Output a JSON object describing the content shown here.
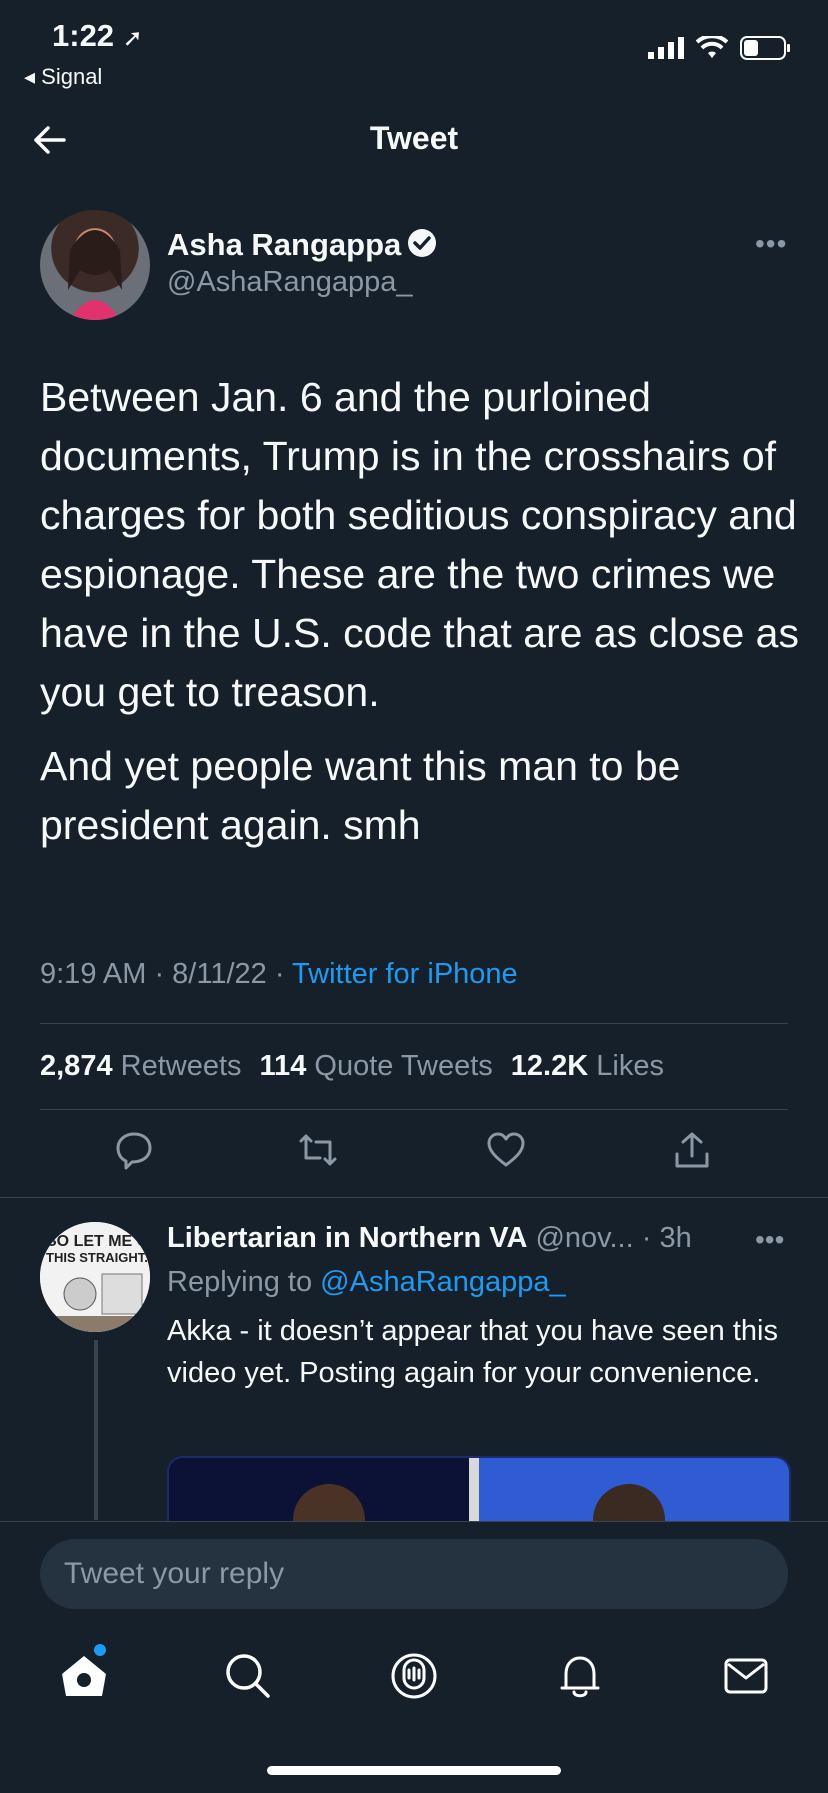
{
  "status_bar": {
    "time": "1:22",
    "back_app": "◂ Signal",
    "icons": [
      "signal-icon",
      "wifi-icon",
      "battery-icon"
    ]
  },
  "header": {
    "title": "Tweet",
    "back_icon": "arrow-left-icon"
  },
  "tweet": {
    "author_name": "Asha Rangappa",
    "author_handle": "@AshaRangappa_",
    "verified": true,
    "body_paragraphs": [
      "Between Jan. 6 and the purloined documents, Trump is in the crosshairs of charges for both seditious conspiracy and espionage. These are the two crimes we have in the U.S. code that are as close as you get to treason.",
      "And yet people want this man to be president again. smh"
    ],
    "time": "9:19 AM · 8/11/22 · ",
    "source": "Twitter for iPhone",
    "stats": {
      "retweets_count": "2,874",
      "retweets_label": "Retweets",
      "quotes_count": "114",
      "quotes_label": "Quote Tweets",
      "likes_count": "12.2K",
      "likes_label": "Likes"
    },
    "action_icons": [
      "reply-icon",
      "retweet-icon",
      "like-icon",
      "share-icon"
    ]
  },
  "reply": {
    "author_name": "Libertarian in Northern VA",
    "meta": "@nov... · 3h",
    "replying_prefix": "Replying to ",
    "replying_handle": "@AshaRangappa_",
    "text": "Akka - it doesn’t appear that you have seen this video yet. Posting again for your convenience.",
    "avatar_text": "SO LET ME GET THIS STRAIGHT..."
  },
  "composer": {
    "placeholder": "Tweet your reply"
  },
  "tab_bar": [
    "home-icon",
    "search-icon",
    "spaces-icon",
    "notifications-icon",
    "messages-icon"
  ],
  "colors": {
    "background": "#15202b",
    "accent": "#1d9bf0",
    "muted": "#8b98a5",
    "divider": "#38444d"
  }
}
